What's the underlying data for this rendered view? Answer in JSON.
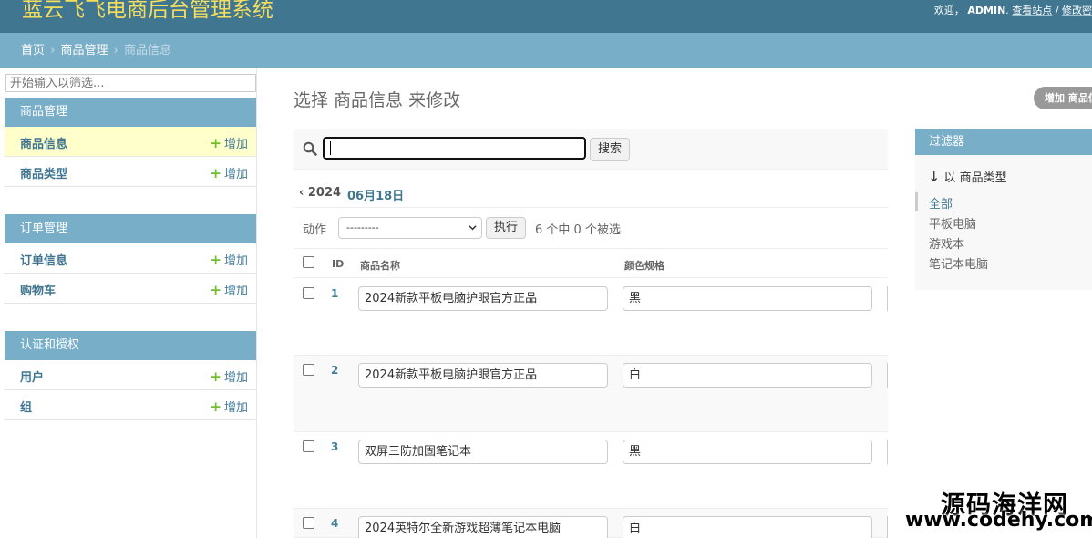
{
  "header": {
    "site_title": "蓝云飞飞电商后台管理系统",
    "welcome": "欢迎，",
    "username": "ADMIN",
    "view_site": "查看站点",
    "separator": "/",
    "change_password": "修改密"
  },
  "breadcrumbs": {
    "home": "首页",
    "app": "商品管理",
    "current": "商品信息",
    "sep": "›"
  },
  "sidebar": {
    "filter_placeholder": "开始输入以筛选...",
    "add_label": "增加",
    "modules": [
      {
        "caption": "商品管理",
        "items": [
          {
            "label": "商品信息"
          },
          {
            "label": "商品类型"
          }
        ]
      },
      {
        "caption": "订单管理",
        "items": [
          {
            "label": "订单信息"
          },
          {
            "label": "购物车"
          }
        ]
      },
      {
        "caption": "认证和授权",
        "items": [
          {
            "label": "用户"
          },
          {
            "label": "组"
          }
        ]
      }
    ]
  },
  "content": {
    "title": "选择 商品信息 来修改",
    "add_button": "增加 商品信息",
    "search_button": "搜索",
    "date_back": "‹ 2024",
    "date_current": "06月18日",
    "action_label": "动作",
    "action_selected": "---------",
    "go_button": "执行",
    "counter": "6 个中 0 个被选",
    "columns": {
      "id": "ID",
      "name": "商品名称",
      "color": "颜色规格"
    },
    "rows": [
      {
        "id": "1",
        "name": "2024新款平板电脑护眼官方正品",
        "color": "黑"
      },
      {
        "id": "2",
        "name": "2024新款平板电脑护眼官方正品",
        "color": "白"
      },
      {
        "id": "3",
        "name": "双屏三防加固笔记本",
        "color": "黑"
      },
      {
        "id": "4",
        "name": "2024英特尔全新游戏超薄笔记本电脑",
        "color": "白"
      }
    ]
  },
  "filter": {
    "title": "过滤器",
    "heading_arrow": "↓",
    "heading": "以 商品类型",
    "options": [
      "全部",
      "平板电脑",
      "游戏本",
      "笔记本电脑"
    ]
  },
  "watermark": {
    "name": "源码海洋网",
    "url": "www.codehy.com"
  }
}
